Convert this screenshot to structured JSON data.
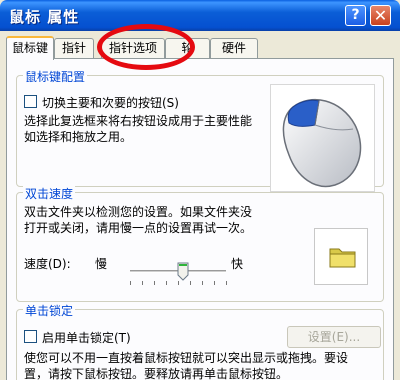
{
  "window": {
    "title": "鼠标 属性",
    "help_label": "?",
    "close_label": "✕"
  },
  "tabs": [
    {
      "label": "鼠标键",
      "active": true
    },
    {
      "label": "指针",
      "active": false
    },
    {
      "label": "指针选项",
      "active": false
    },
    {
      "label": "轮",
      "active": false
    },
    {
      "label": "硬件",
      "active": false
    }
  ],
  "button_config": {
    "title": "鼠标键配置",
    "checkbox_label": "切换主要和次要的按钮(S)",
    "checked": false,
    "description_line1": "选择此复选框来将右按钮设成用于主要性能",
    "description_line2": "如选择和拖放之用。"
  },
  "double_click": {
    "title": "双击速度",
    "description_line1": "双击文件夹以检测您的设置。如果文件夹没",
    "description_line2": "打开或关闭，请用慢一点的设置再试一次。",
    "speed_label": "速度(D):",
    "slow_label": "慢",
    "fast_label": "快",
    "speed_level": 0.55
  },
  "click_lock": {
    "title": "单击锁定",
    "checkbox_label": "启用单击锁定(T)",
    "checked": false,
    "settings_label": "设置(E)...",
    "description_line1": "使您可以不用一直按着鼠标按钮就可以突出显示或拖拽。要设",
    "description_line2": "置，请按下鼠标按钮。要释放请再单击鼠标按钮。"
  },
  "colors": {
    "titlebar": "#0b5ed7",
    "group_title": "#0046d5",
    "annotation_circle": "#e50a10",
    "active_tab_highlight": "#f9b83b"
  }
}
